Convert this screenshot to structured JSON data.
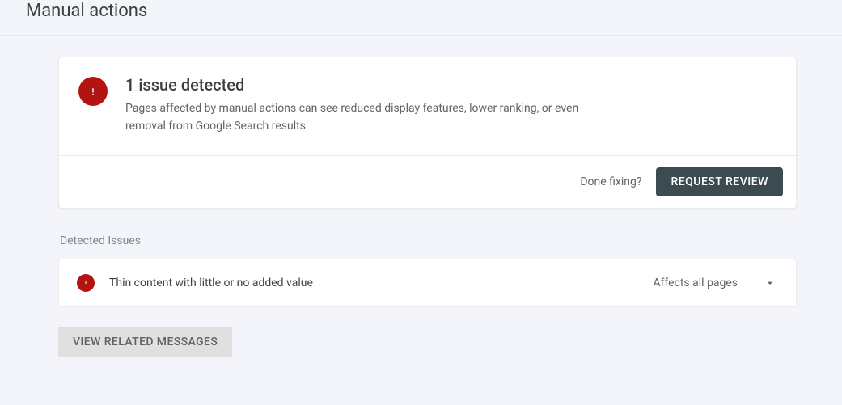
{
  "page": {
    "title": "Manual actions"
  },
  "summary": {
    "title": "1 issue detected",
    "description": "Pages affected by manual actions can see reduced display features, lower ranking, or even removal from Google Search results."
  },
  "action_bar": {
    "done_fixing_label": "Done fixing?",
    "request_review_label": "REQUEST REVIEW"
  },
  "detected_issues": {
    "section_label": "Detected Issues",
    "items": [
      {
        "title": "Thin content with little or no added value",
        "scope": "Affects all pages"
      }
    ]
  },
  "related_messages_label": "VIEW RELATED MESSAGES",
  "colors": {
    "alert": "#b31412",
    "primary_button": "#3c4a52"
  }
}
